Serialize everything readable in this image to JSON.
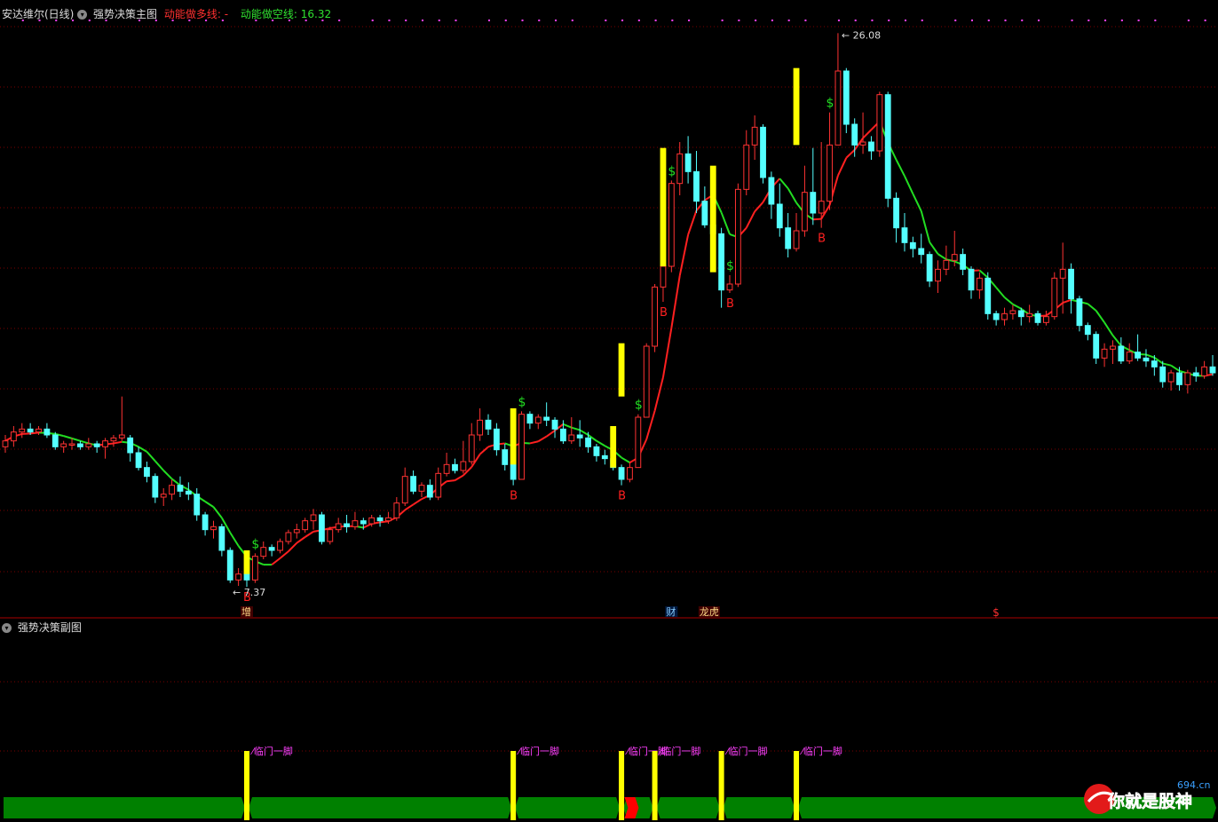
{
  "header": {
    "stock_title": "安达维尔(日线)",
    "main_indicator": "强势决策主图",
    "long_line_label": "动能做多线: -",
    "short_line_label": "动能做空线: 16.32"
  },
  "sub_header": {
    "title": "强势决策副图"
  },
  "price_labels": {
    "high": "26.08",
    "low": "7.37"
  },
  "markers": {
    "buy": "B",
    "sell": "$"
  },
  "event_tags": {
    "zeng": "增",
    "cai": "财",
    "long": "龙虎",
    "dollar": "$"
  },
  "sub_signals": {
    "label": "临门一脚"
  },
  "watermark": {
    "brand": "你就是股神",
    "site": "694.cn"
  },
  "colors": {
    "up": "#ff3232",
    "down": "#54ffff",
    "long_line": "#ff2020",
    "short_line": "#22dd22",
    "signal": "#ffff00",
    "band": "#008000",
    "band_red": "#ff0000",
    "label_magenta": "#ff40ff"
  },
  "chart_data": {
    "type": "candlestick",
    "y_range_approx": [
      6.8,
      26.6
    ],
    "high": 26.08,
    "low": 7.37,
    "candles": [
      [
        12.1,
        12.3,
        12.5,
        11.9
      ],
      [
        12.3,
        12.6,
        12.8,
        12.1
      ],
      [
        12.6,
        12.7,
        12.9,
        12.4
      ],
      [
        12.7,
        12.6,
        12.9,
        12.5
      ],
      [
        12.6,
        12.7,
        12.8,
        12.5
      ],
      [
        12.7,
        12.5,
        12.9,
        12.4
      ],
      [
        12.5,
        12.1,
        12.6,
        12.0
      ],
      [
        12.1,
        12.2,
        12.3,
        11.9
      ],
      [
        12.2,
        12.2,
        12.4,
        12.0
      ],
      [
        12.2,
        12.1,
        12.3,
        12.0
      ],
      [
        12.1,
        12.2,
        12.4,
        12.0
      ],
      [
        12.2,
        12.1,
        12.3,
        11.9
      ],
      [
        12.1,
        12.3,
        12.4,
        11.7
      ],
      [
        12.3,
        12.4,
        12.5,
        12.1
      ],
      [
        12.4,
        12.5,
        13.8,
        12.3
      ],
      [
        12.4,
        11.9,
        12.5,
        11.6
      ],
      [
        11.9,
        11.4,
        12.1,
        11.3
      ],
      [
        11.4,
        11.1,
        11.6,
        10.9
      ],
      [
        11.1,
        10.4,
        11.2,
        10.2
      ],
      [
        10.4,
        10.5,
        10.7,
        10.1
      ],
      [
        10.5,
        10.8,
        11.0,
        10.3
      ],
      [
        10.8,
        10.6,
        11.1,
        10.4
      ],
      [
        10.6,
        10.5,
        10.9,
        10.3
      ],
      [
        10.5,
        9.8,
        10.7,
        9.6
      ],
      [
        9.8,
        9.3,
        9.9,
        9.1
      ],
      [
        9.3,
        9.4,
        9.6,
        9.0
      ],
      [
        9.4,
        8.6,
        9.5,
        8.4
      ],
      [
        8.6,
        7.6,
        8.7,
        7.5
      ],
      [
        7.6,
        7.8,
        8.0,
        7.4
      ],
      [
        7.8,
        7.6,
        8.0,
        7.37
      ],
      [
        7.6,
        8.4,
        8.5,
        7.5
      ],
      [
        8.4,
        8.7,
        8.9,
        8.3
      ],
      [
        8.7,
        8.6,
        8.8,
        8.4
      ],
      [
        8.6,
        8.9,
        9.0,
        8.5
      ],
      [
        8.9,
        9.2,
        9.3,
        8.8
      ],
      [
        9.2,
        9.3,
        9.5,
        9.0
      ],
      [
        9.3,
        9.6,
        9.7,
        9.2
      ],
      [
        9.6,
        9.8,
        10.0,
        9.3
      ],
      [
        9.8,
        8.9,
        9.9,
        8.8
      ],
      [
        8.9,
        9.3,
        9.4,
        8.8
      ],
      [
        9.3,
        9.5,
        9.7,
        9.2
      ],
      [
        9.5,
        9.4,
        9.8,
        9.2
      ],
      [
        9.4,
        9.6,
        9.9,
        9.3
      ],
      [
        9.6,
        9.5,
        9.7,
        9.3
      ],
      [
        9.5,
        9.7,
        9.8,
        9.4
      ],
      [
        9.7,
        9.6,
        9.8,
        9.4
      ],
      [
        9.6,
        9.7,
        9.9,
        9.5
      ],
      [
        9.7,
        10.2,
        10.4,
        9.6
      ],
      [
        10.2,
        11.1,
        11.4,
        10.1
      ],
      [
        11.1,
        10.6,
        11.3,
        10.5
      ],
      [
        10.6,
        10.8,
        10.9,
        10.4
      ],
      [
        10.8,
        10.4,
        11.0,
        10.3
      ],
      [
        10.4,
        11.2,
        11.4,
        10.3
      ],
      [
        11.2,
        11.5,
        11.9,
        11.1
      ],
      [
        11.5,
        11.3,
        11.7,
        11.2
      ],
      [
        11.3,
        11.6,
        12.3,
        11.2
      ],
      [
        11.6,
        12.5,
        12.9,
        11.5
      ],
      [
        12.5,
        13.0,
        13.4,
        12.3
      ],
      [
        13.0,
        12.7,
        13.2,
        12.5
      ],
      [
        12.7,
        12.0,
        12.9,
        11.8
      ],
      [
        12.0,
        11.5,
        12.2,
        11.3
      ],
      [
        11.5,
        11.0,
        11.6,
        10.8
      ],
      [
        11.0,
        13.2,
        13.3,
        11.0
      ],
      [
        13.2,
        12.9,
        13.3,
        12.7
      ],
      [
        12.9,
        13.1,
        13.2,
        12.7
      ],
      [
        13.1,
        13.0,
        13.6,
        12.8
      ],
      [
        13.0,
        12.7,
        13.1,
        12.4
      ],
      [
        12.7,
        12.3,
        13.0,
        12.2
      ],
      [
        12.3,
        12.5,
        13.1,
        12.2
      ],
      [
        12.5,
        12.4,
        13.0,
        12.1
      ],
      [
        12.4,
        12.1,
        12.6,
        11.9
      ],
      [
        12.1,
        11.8,
        12.2,
        11.6
      ],
      [
        11.8,
        11.7,
        12.0,
        11.5
      ],
      [
        11.7,
        11.4,
        11.9,
        11.3
      ],
      [
        11.4,
        11.0,
        11.5,
        10.8
      ],
      [
        11.0,
        11.4,
        11.6,
        10.9
      ],
      [
        11.4,
        13.1,
        13.2,
        11.4
      ],
      [
        13.1,
        15.5,
        15.6,
        13.1
      ],
      [
        15.5,
        17.5,
        17.6,
        15.3
      ],
      [
        17.5,
        18.2,
        18.4,
        17.0
      ],
      [
        18.2,
        21.0,
        21.1,
        18.0
      ],
      [
        21.0,
        22.0,
        22.4,
        20.6
      ],
      [
        22.0,
        21.4,
        22.6,
        21.0
      ],
      [
        21.4,
        20.4,
        22.1,
        20.0
      ],
      [
        20.4,
        19.6,
        20.9,
        19.5
      ],
      [
        19.6,
        19.3,
        20.5,
        19.0
      ],
      [
        19.3,
        17.4,
        19.5,
        16.8
      ],
      [
        17.4,
        17.6,
        17.9,
        17.3
      ],
      [
        17.6,
        20.8,
        21.0,
        17.5
      ],
      [
        20.8,
        22.3,
        22.8,
        20.6
      ],
      [
        22.3,
        22.9,
        23.3,
        21.8
      ],
      [
        22.9,
        21.2,
        23.0,
        21.0
      ],
      [
        21.2,
        20.3,
        21.4,
        19.8
      ],
      [
        20.3,
        19.5,
        21.0,
        19.2
      ],
      [
        19.5,
        18.8,
        20.0,
        18.5
      ],
      [
        18.8,
        19.4,
        20.0,
        18.7
      ],
      [
        19.4,
        20.7,
        21.6,
        19.2
      ],
      [
        20.7,
        20.0,
        22.2,
        19.6
      ],
      [
        20.0,
        20.4,
        22.4,
        19.5
      ],
      [
        20.4,
        22.3,
        23.4,
        20.1
      ],
      [
        22.3,
        24.8,
        26.08,
        22.3
      ],
      [
        24.8,
        23.0,
        24.9,
        22.7
      ],
      [
        23.0,
        22.3,
        23.2,
        21.9
      ],
      [
        22.3,
        22.4,
        23.4,
        22.0
      ],
      [
        22.4,
        22.1,
        22.6,
        21.8
      ],
      [
        22.1,
        24.0,
        24.1,
        21.9
      ],
      [
        24.0,
        20.5,
        24.1,
        20.2
      ],
      [
        20.5,
        19.5,
        20.7,
        19.0
      ],
      [
        19.5,
        19.0,
        20.0,
        18.7
      ],
      [
        19.0,
        18.8,
        19.2,
        18.5
      ],
      [
        18.8,
        18.6,
        19.3,
        18.3
      ],
      [
        18.6,
        17.7,
        18.7,
        17.5
      ],
      [
        17.7,
        18.1,
        18.4,
        17.3
      ],
      [
        18.1,
        18.4,
        18.9,
        17.9
      ],
      [
        18.4,
        18.6,
        19.4,
        18.2
      ],
      [
        18.6,
        18.1,
        18.8,
        17.9
      ],
      [
        18.1,
        17.4,
        18.2,
        17.1
      ],
      [
        17.4,
        17.8,
        18.0,
        17.1
      ],
      [
        17.8,
        16.6,
        18.0,
        16.4
      ],
      [
        16.6,
        16.4,
        16.7,
        16.2
      ],
      [
        16.4,
        16.6,
        16.8,
        16.2
      ],
      [
        16.6,
        16.7,
        16.9,
        16.4
      ],
      [
        16.7,
        16.5,
        16.8,
        16.2
      ],
      [
        16.5,
        16.6,
        16.9,
        16.3
      ],
      [
        16.6,
        16.3,
        16.7,
        16.2
      ],
      [
        16.3,
        16.5,
        16.7,
        16.2
      ],
      [
        16.5,
        17.8,
        18.0,
        16.4
      ],
      [
        17.8,
        18.1,
        19.0,
        16.6
      ],
      [
        18.1,
        17.1,
        18.3,
        16.6
      ],
      [
        17.1,
        16.2,
        17.2,
        16.0
      ],
      [
        16.2,
        15.9,
        16.3,
        15.7
      ],
      [
        15.9,
        15.1,
        16.0,
        14.9
      ],
      [
        15.1,
        15.4,
        15.6,
        14.8
      ],
      [
        15.4,
        15.5,
        15.7,
        14.9
      ],
      [
        15.5,
        15.0,
        15.8,
        14.9
      ],
      [
        15.0,
        15.3,
        15.6,
        14.9
      ],
      [
        15.3,
        15.1,
        15.9,
        15.0
      ],
      [
        15.1,
        15.0,
        15.4,
        14.8
      ],
      [
        15.0,
        14.8,
        15.2,
        14.5
      ],
      [
        14.8,
        14.3,
        15.0,
        14.1
      ],
      [
        14.3,
        14.6,
        14.7,
        14.0
      ],
      [
        14.6,
        14.2,
        14.8,
        14.0
      ],
      [
        14.2,
        14.6,
        14.7,
        13.9
      ],
      [
        14.6,
        14.5,
        14.8,
        14.3
      ],
      [
        14.5,
        14.8,
        15.0,
        14.4
      ],
      [
        14.8,
        14.6,
        15.2,
        14.5
      ]
    ],
    "buy_marks": [
      29,
      61,
      74,
      79,
      87,
      98
    ],
    "sell_marks": [
      30,
      62,
      76,
      80,
      87,
      99
    ],
    "yellow_bars": [
      [
        29,
        7.8,
        8.6
      ],
      [
        61,
        11.5,
        13.4
      ],
      [
        73,
        11.4,
        12.8
      ],
      [
        74,
        13.8,
        15.6
      ],
      [
        79,
        18.2,
        22.2
      ],
      [
        85,
        18.0,
        21.6
      ],
      [
        95,
        22.3,
        24.9
      ]
    ],
    "long_line_start": 0,
    "long_line_end": 99,
    "sub_signal_indices": [
      29,
      61,
      74,
      78,
      86,
      95
    ],
    "band_red_index": 75
  }
}
